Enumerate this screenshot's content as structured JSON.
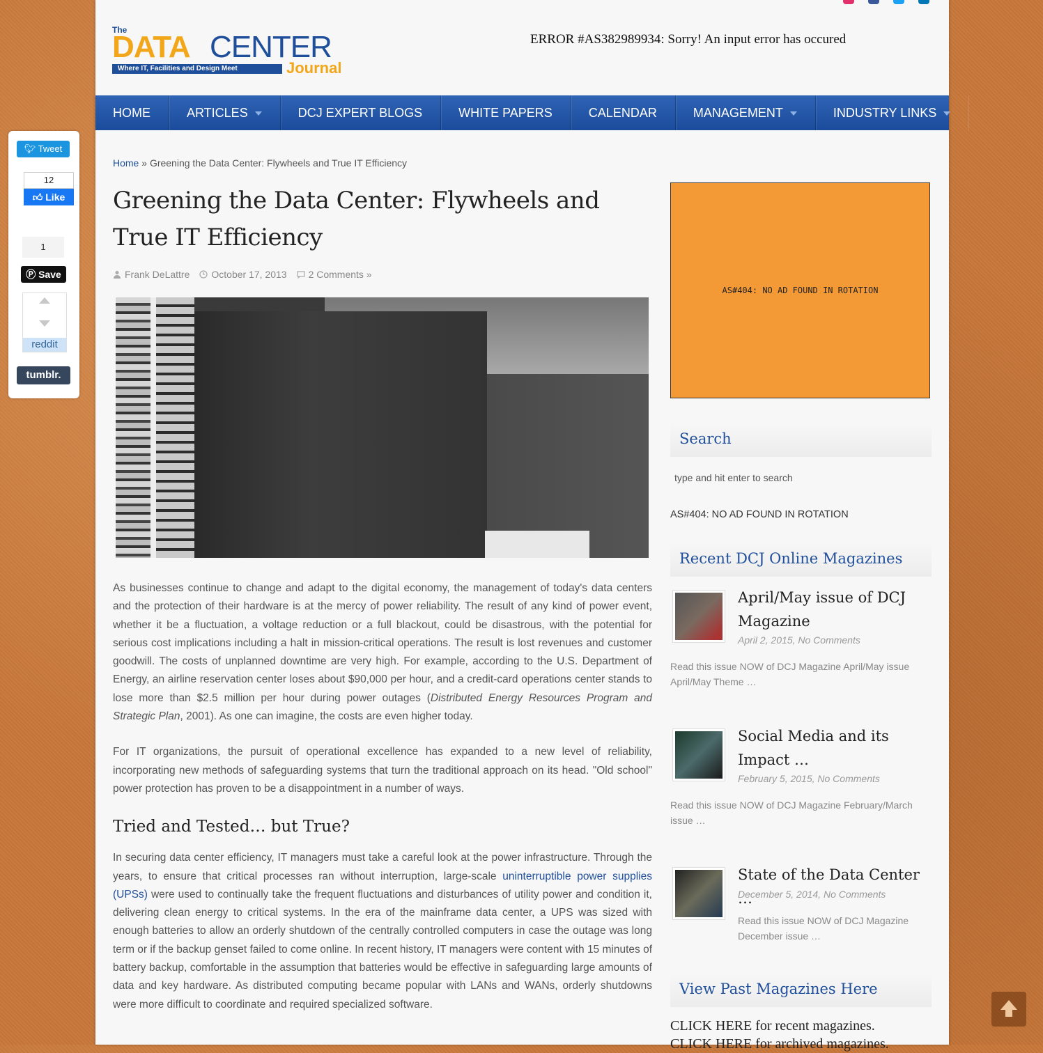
{
  "header": {
    "logo": {
      "the": "The",
      "data": "DATA",
      "center": "CENTER",
      "tagline": "Where IT, Facilities and Design Meet",
      "journal": "Journal"
    },
    "error_message": "ERROR #AS382989934: Sorry! An input error has occured",
    "social_icons": [
      {
        "name": "instagram-icon",
        "color": "#e1306c"
      },
      {
        "name": "facebook-icon",
        "color": "#3b5998"
      },
      {
        "name": "twitter-icon",
        "color": "#1da1f2"
      },
      {
        "name": "linkedin-icon",
        "color": "#0077b5"
      }
    ]
  },
  "nav": {
    "items": [
      {
        "label": "HOME",
        "has_dropdown": false
      },
      {
        "label": "ARTICLES",
        "has_dropdown": true
      },
      {
        "label": "DCJ EXPERT BLOGS",
        "has_dropdown": false
      },
      {
        "label": "WHITE PAPERS",
        "has_dropdown": false
      },
      {
        "label": "CALENDAR",
        "has_dropdown": false
      },
      {
        "label": "MANAGEMENT",
        "has_dropdown": true
      },
      {
        "label": "INDUSTRY LINKS",
        "has_dropdown": true
      }
    ]
  },
  "sharebar": {
    "tweet_label": "Tweet",
    "fb_count": "12",
    "fb_like_label": "Like",
    "pin_count": "1",
    "pin_save_label": "Save",
    "reddit_label": "reddit",
    "tumblr_label": "tumblr."
  },
  "breadcrumb": {
    "home": "Home",
    "separator": " » ",
    "current": "Greening the Data Center: Flywheels and True IT Efficiency"
  },
  "article": {
    "title": "Greening the Data Center: Flywheels and True IT Efficiency",
    "author": "Frank DeLattre",
    "date": "October 17, 2013",
    "comments": "2 Comments »",
    "hero_alt": "Data center server room with rows of black cabinets",
    "p1_a": "As businesses continue to change and adapt to the digital economy, the management of today's data centers and the protection of their hardware is at the mercy of power reliability. The result of any kind of power event, whether it be a fluctuation, a voltage reduction or a full blackout, could be disastrous, with the potential for serious cost implications including a halt in mission-critical operations. The result is lost revenues and customer goodwill. The costs of unplanned downtime are very high. For example, according to the U.S. Department of Energy, an airline reservation center loses about $90,000 per hour, and a credit-card operations center stands to lose more than $2.5 million per hour during power outages (",
    "p1_italic": "Distributed Energy Resources Program and Strategic Plan",
    "p1_b": ", 2001). As one can imagine, the costs are even higher today.",
    "p2": "For IT organizations, the pursuit of operational excellence has expanded to a new level of reliability, incorporating new methods of safeguarding systems that turn the traditional approach on its head. \"Old school\" power protection has proven to be a disappointment in a number of ways.",
    "h2": "Tried and Tested… but True?",
    "p3_a": "In securing data center efficiency, IT managers must take a careful look at the power infrastructure. Through the years, to ensure that critical processes ran without interruption, large-scale ",
    "p3_link": "uninterruptible power supplies (UPSs)",
    "p3_b": " were used to continually take the frequent fluctuations and disturbances of utility power and condition it, delivering clean energy to critical systems. In the era of the mainframe data center, a UPS was sized with enough batteries to allow an orderly shutdown of the centrally controlled computers in case the outage was long term or if the backup genset failed to come online. In recent history, IT managers were content with 15 minutes of battery backup, comfortable in the assumption that batteries would be effective in safeguarding large amounts of data and key hardware. As distributed computing became popular with LANs and WANs, orderly shutdowns were more difficult to coordinate and required specialized software."
  },
  "sidebar": {
    "ad_text": "AS#404: NO AD FOUND IN ROTATION",
    "search_title": "Search",
    "search_placeholder": "type and hit enter to search",
    "ad_text_2": "AS#404: NO AD FOUND IN ROTATION",
    "recent_title": "Recent DCJ Online Magazines",
    "magazines": [
      {
        "title": "April/May issue of DCJ Magazine",
        "date": "April 2, 2015, No Comments",
        "excerpt": "Read this issue NOW of DCJ Magazine April/May issue  April/May Theme …"
      },
      {
        "title": "Social Media and its Impact …",
        "date": "February 5, 2015, No Comments",
        "excerpt": "Read this issue NOW of DCJ Magazine February/March issue   …"
      },
      {
        "title": "State of the Data Center …",
        "date": "December 5, 2014, No Comments",
        "excerpt": "Read this issue NOW of DCJ Magazine December issue   …"
      }
    ],
    "past_title": "View Past Magazines Here",
    "past_links": [
      "CLICK HERE for recent magazines.",
      "CLICK HERE for archived magazines."
    ]
  }
}
